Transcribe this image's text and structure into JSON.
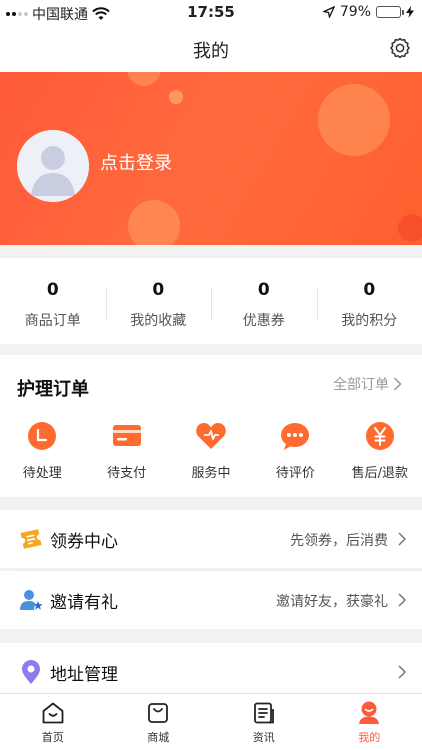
{
  "status_bar": {
    "carrier": "中国联通",
    "time": "17:55",
    "battery_percent": "79%",
    "battery_level": 0.79
  },
  "nav": {
    "title": "我的",
    "settings_icon": "gear-icon"
  },
  "profile": {
    "login_label": "点击登录",
    "avatar_icon": "default-avatar-icon"
  },
  "stats": [
    {
      "value": "0",
      "label": "商品订单"
    },
    {
      "value": "0",
      "label": "我的收藏"
    },
    {
      "value": "0",
      "label": "优惠券"
    },
    {
      "value": "0",
      "label": "我的积分"
    }
  ],
  "care_orders": {
    "title": "护理订单",
    "all_label": "全部订单",
    "items": [
      {
        "label": "待处理",
        "icon": "pending-icon"
      },
      {
        "label": "待支付",
        "icon": "card-icon"
      },
      {
        "label": "服务中",
        "icon": "heart-icon"
      },
      {
        "label": "待评价",
        "icon": "comment-icon"
      },
      {
        "label": "售后/退款",
        "icon": "yen-icon"
      }
    ]
  },
  "menu": {
    "coupon_center": {
      "label": "领券中心",
      "hint": "先领券，后消费"
    },
    "invite": {
      "label": "邀请有礼",
      "hint": "邀请好友，获豪礼"
    },
    "address": {
      "label": "地址管理",
      "hint": ""
    }
  },
  "tabs": [
    {
      "label": "首页",
      "icon": "home-icon"
    },
    {
      "label": "商城",
      "icon": "shopping-bag-icon"
    },
    {
      "label": "资讯",
      "icon": "news-icon"
    },
    {
      "label": "我的",
      "icon": "profile-icon"
    }
  ],
  "colors": {
    "accent": "#ff5a3a",
    "icon_orange": "#ff6a2f",
    "banner": "#ff5f38"
  }
}
